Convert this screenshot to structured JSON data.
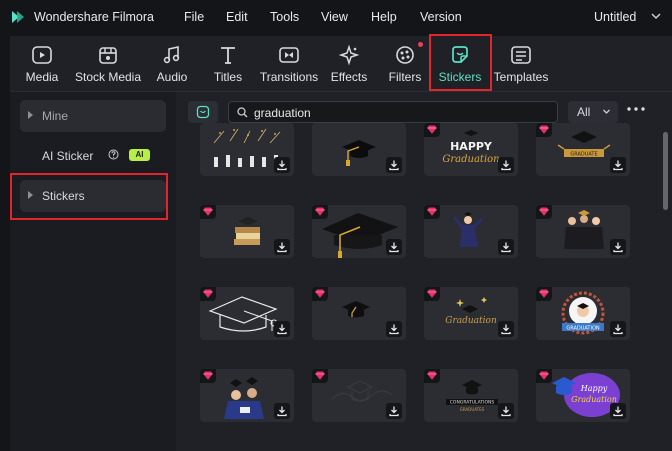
{
  "app": {
    "name": "Wondershare Filmora",
    "document_title": "Untitled"
  },
  "menu": [
    "File",
    "Edit",
    "Tools",
    "View",
    "Help",
    "Version"
  ],
  "toolbar": [
    {
      "label": "Media",
      "icon": "media-icon"
    },
    {
      "label": "Stock Media",
      "icon": "stock-media-icon"
    },
    {
      "label": "Audio",
      "icon": "audio-icon"
    },
    {
      "label": "Titles",
      "icon": "titles-icon"
    },
    {
      "label": "Transitions",
      "icon": "transitions-icon"
    },
    {
      "label": "Effects",
      "icon": "effects-icon"
    },
    {
      "label": "Filters",
      "icon": "filters-icon",
      "notification_dot": true
    },
    {
      "label": "Stickers",
      "icon": "stickers-icon",
      "active": true
    },
    {
      "label": "Templates",
      "icon": "templates-icon"
    }
  ],
  "sidebar": {
    "items": [
      {
        "label": "Mine"
      },
      {
        "label": "AI Sticker",
        "badge": "AI"
      },
      {
        "label": "Stickers",
        "highlighted": true
      }
    ]
  },
  "search": {
    "value": "graduation",
    "filter": "All"
  },
  "stickers": [
    {
      "name": "fireworks-celebration",
      "premium": false
    },
    {
      "name": "graduation-cap-tassel",
      "premium": false
    },
    {
      "name": "happy-graduation-text",
      "premium": true
    },
    {
      "name": "cap-with-banner",
      "premium": true
    },
    {
      "name": "stack-of-books",
      "premium": true
    },
    {
      "name": "large-cap-tassel",
      "premium": true
    },
    {
      "name": "jumping-graduate",
      "premium": true
    },
    {
      "name": "group-of-graduates",
      "premium": true
    },
    {
      "name": "cap-outline-drawing",
      "premium": true
    },
    {
      "name": "small-cap",
      "premium": true
    },
    {
      "name": "sparkle-cap-lettering",
      "premium": true
    },
    {
      "name": "laurel-graduation-badge",
      "premium": true
    },
    {
      "name": "graduates-throwing-caps",
      "premium": true
    },
    {
      "name": "cap-line-art",
      "premium": true
    },
    {
      "name": "congratulations-cap",
      "premium": true
    },
    {
      "name": "happy-graduation-bubble",
      "premium": true
    }
  ],
  "colors": {
    "accent": "#5ce0c4",
    "highlight_border": "#e0262b",
    "premium_gem": "#e6316a",
    "ai_badge": "#b8ef45"
  }
}
